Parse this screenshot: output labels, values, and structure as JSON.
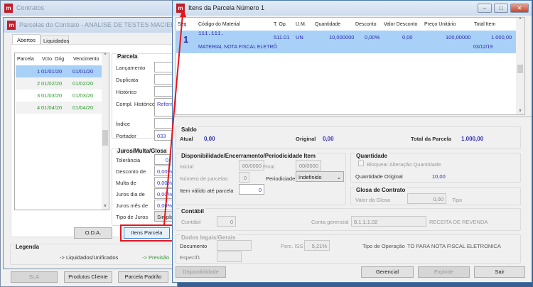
{
  "back_window": {
    "title": "Contratos",
    "inner_title": "Parcelas do Contrato - ANALISE DE TESTES MACIEL FOR BUSINESS",
    "tabs": [
      "Abertos",
      "Liquidados"
    ],
    "grid": {
      "headers": [
        "Parcela",
        "Vcto. Orig",
        "Vencimento"
      ],
      "rows": [
        [
          "1",
          "01/01/20",
          "01/01/20"
        ],
        [
          "2",
          "01/02/20",
          "01/02/20"
        ],
        [
          "3",
          "01/03/20",
          "01/03/20"
        ],
        [
          "4",
          "01/04/20",
          "01/04/20"
        ]
      ]
    },
    "parcela": {
      "title": "Parcela",
      "lancamento": "Lançamento",
      "duplicata": "Duplicata",
      "historico": "Histórico",
      "compl_historico": "Compl. Histórico",
      "compl_value": "Referen",
      "indice": "Índice",
      "portador": "Portador",
      "portador_value": "033"
    },
    "juros": {
      "title": "Juros/Multa/Glosa",
      "tolerancia": "Tolerância",
      "tolerancia_value": "0",
      "desconto": "Desconto de",
      "desconto_value": "0,00%",
      "multa": "Multa de",
      "multa_value": "0,00%",
      "juros_dia": "Juros dia de",
      "juros_dia_value": "0,00%",
      "juros_mes": "Juros mês de",
      "juros_mes_value": "0,00%",
      "tipo": "Tipo de Juros",
      "tipo_value": "Simples"
    },
    "buttons": {
      "oda": "O.D.A.",
      "itens": "Itens Parcela",
      "sla": "SLA",
      "produtos": "Produtos Cliente",
      "parcela_padrao": "Parcela Padrão"
    },
    "legenda": {
      "title": "Legenda",
      "liquidados": "-> Liquidados/Unificados",
      "previsao": "-> Previsão"
    }
  },
  "front_window": {
    "title": "Itens da Parcela Número 1",
    "grid": {
      "headers": [
        "Seq",
        "Código do Material",
        "T. Op.",
        "U.M.",
        "Quantidade",
        "Desconto",
        "Valor Desconto",
        "Preço Unitário",
        "Total Item"
      ],
      "row": {
        "seq": "1",
        "codigo": "111.111.",
        "top": "511.01",
        "um": "UN",
        "quantidade": "10,000000",
        "desconto": "0,00%",
        "valor_desconto": "0,00",
        "preco": "100,00000",
        "total": "1.000,00",
        "descricao": "MATERIAL NOTA FISCAL ELETRÔ",
        "data": "03/12/19"
      }
    },
    "saldo": {
      "title": "Saldo",
      "atual": "Atual",
      "atual_value": "0,00",
      "original": "Original",
      "original_value": "0,00",
      "total": "Total da Parcela",
      "total_value": "1.000,00"
    },
    "disp": {
      "title": "Disponibilidade/Encerramento/Periodicidade Item",
      "inicial": "Inicial",
      "inicial_value": "00/0000",
      "final": "Final",
      "final_value": "00/0000",
      "num_parcelas": "Número de parcelas",
      "num_parcelas_value": "0",
      "periodicidade": "Periodiciade",
      "periodicidade_value": "Indefinido",
      "valido": "Item válido até parcela",
      "valido_value": "0"
    },
    "quantidade": {
      "title": "Quantidade",
      "bloquear": "Bloquear Alteração Quantidade",
      "original": "Quantidade Original",
      "original_value": "10,00"
    },
    "glosa": {
      "title": "Glosa de Contrato",
      "valor": "Valor da Glosa",
      "valor_value": "0,00",
      "tipo": "Tipo"
    },
    "contabil": {
      "title": "Contábil",
      "contabil": "Contábil",
      "contabil_value": "0",
      "conta": "Conta gerencial",
      "conta_value": "8.1.1.1.02",
      "conta_desc": "RECEITA DE REVENDA"
    },
    "dados": {
      "title": "Dados legais/Gerais",
      "documento": "Documento",
      "perc_iss": "Perc. ISS",
      "perc_iss_value": "5,21%",
      "tipo_op": "Tipo de Operação",
      "tipo_op_value": "TO PARA NOTA FISCAL ELETRONICA",
      "especif": "Especif1"
    },
    "buttons": {
      "disponibilidade": "Disponibilidade",
      "gerencial": "Gerencial",
      "explode": "Explode",
      "sair": "Sair"
    }
  },
  "colors": {
    "highlight": "#e8141e",
    "selection": "#a9d1f7",
    "link_blue": "#3030b0",
    "green": "#2e9a2e"
  }
}
